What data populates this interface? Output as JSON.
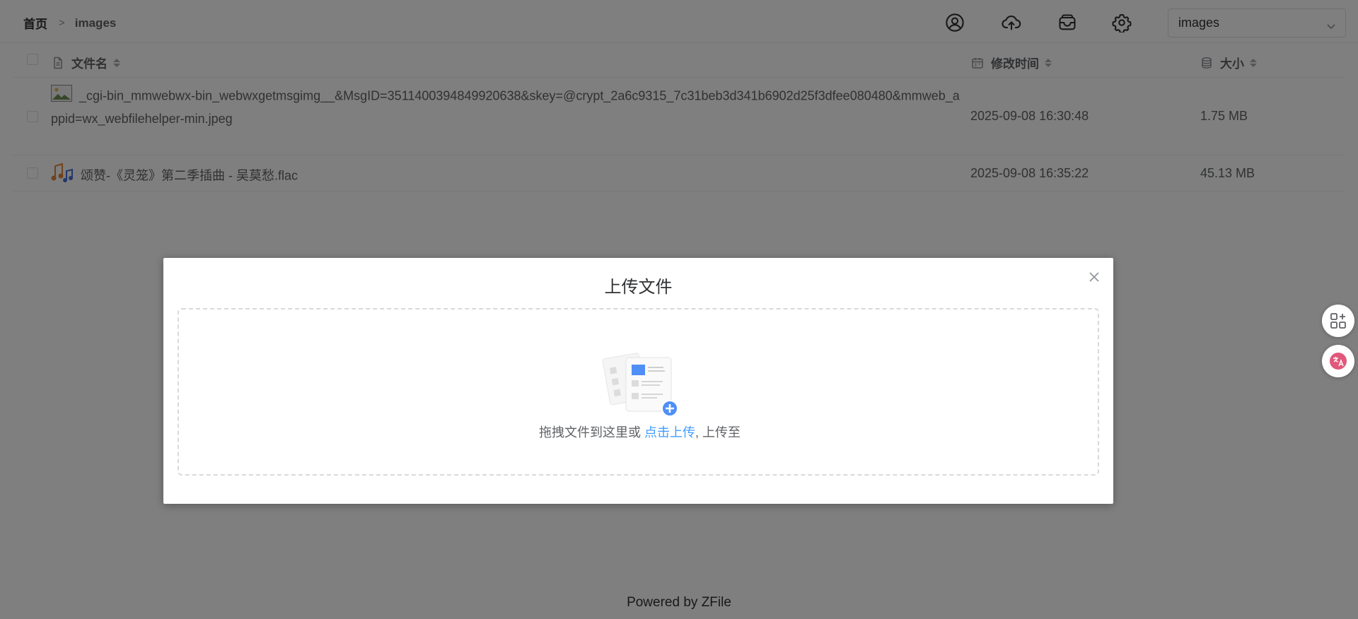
{
  "header": {
    "breadcrumb_home": "首页",
    "breadcrumb_current": "images",
    "icons": [
      "user-circle-icon",
      "cloud-upload-icon",
      "wallet-icon",
      "gear-icon"
    ],
    "storage_select_value": "images"
  },
  "table": {
    "columns": {
      "name": "文件名",
      "modified": "修改时间",
      "size": "大小"
    },
    "rows": [
      {
        "icon": "image-file-icon",
        "name": "_cgi-bin_mmwebwx-bin_webwxgetmsgimg__&MsgID=3511400394849920638&skey=@crypt_2a6c9315_7c31beb3d341b6902d25f3dfee080480&mmweb_appid=wx_webfilehelper-min.jpeg",
        "modified": "2025-09-08 16:30:48",
        "size": "1.75 MB"
      },
      {
        "icon": "music-file-icon",
        "name": "颂赞-《灵笼》第二季插曲 - 吴莫愁.flac",
        "modified": "2025-09-08 16:35:22",
        "size": "45.13 MB"
      }
    ]
  },
  "footer": {
    "prefix": "Powered by ",
    "brand": "ZFile"
  },
  "dialog": {
    "title": "上传文件",
    "drop_text_before": "拖拽文件到这里或 ",
    "drop_link": "点击上传",
    "drop_text_after": ", 上传至"
  },
  "colors": {
    "accent": "#409eff",
    "mask": "rgba(0,0,0,0.5)",
    "translate_badge": "#e0587b"
  }
}
